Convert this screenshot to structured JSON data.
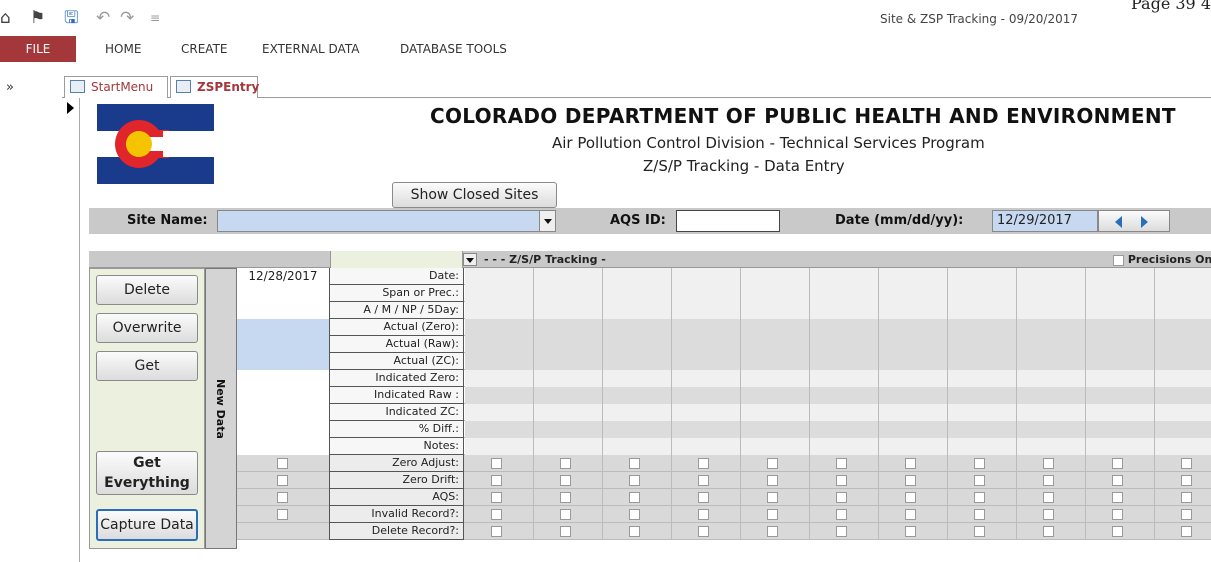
{
  "window": {
    "title": "Site & ZSP Tracking - 09/20/2017",
    "page_number": "Page 39 4"
  },
  "ribbon": {
    "tabs": [
      "FILE",
      "HOME",
      "CREATE",
      "EXTERNAL DATA",
      "DATABASE TOOLS"
    ]
  },
  "object_tabs": [
    "StartMenu",
    "ZSPEntry"
  ],
  "header": {
    "org": "COLORADO DEPARTMENT OF PUBLIC HEALTH AND ENVIRONMENT",
    "division": "Air Pollution Control Division - Technical Services Program",
    "form_title": "Z/S/P Tracking - Data Entry",
    "show_closed_label": "Show Closed Sites"
  },
  "filters": {
    "site_name_label": "Site Name:",
    "site_name_value": "",
    "aqs_label": "AQS ID:",
    "aqs_value": "",
    "date_label": "Date (mm/dd/yy):",
    "date_value": "12/29/2017"
  },
  "grid": {
    "header_text": "- - - Z/S/P Tracking -",
    "precisions_label": "Precisions Only",
    "date_value": "12/28/2017",
    "new_data_label": "New Data",
    "text_rows": [
      "Date:",
      "Span or Prec.:",
      "A / M / NP / 5Day:",
      "Actual (Zero):",
      "Actual (Raw):",
      "Actual (ZC):",
      "Indicated Zero:",
      "Indicated Raw :",
      "Indicated ZC:",
      "% Diff.:",
      "Notes:"
    ],
    "check_rows": [
      "Zero Adjust:",
      "Zero Drift:",
      "AQS:",
      "Invalid Record?:",
      "Delete Record?:"
    ]
  },
  "buttons": {
    "delete": "Delete",
    "overwrite": "Overwrite",
    "get": "Get",
    "get_everything": "Get Everything",
    "capture": "Capture Data"
  },
  "colors": {
    "file_tab": "#a4373a",
    "input_blue": "#c6d9f1",
    "panel_green": "#ebf1de",
    "flag_blue": "#1a3a8c",
    "flag_red": "#e0262b",
    "flag_gold": "#f5c400"
  }
}
